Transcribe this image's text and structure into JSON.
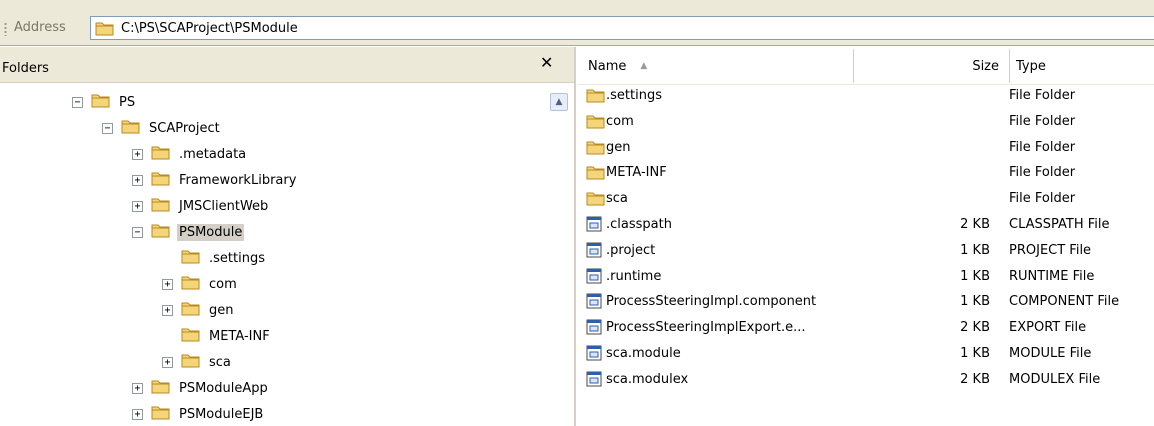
{
  "address": {
    "label": "Address",
    "path": "C:\\PS\\SCAProject\\PSModule"
  },
  "folders_pane": {
    "title": "Folders",
    "close_glyph": "✕",
    "tree": [
      {
        "label": "PS",
        "expander": "⊟"
      },
      {
        "label": "SCAProject",
        "expander": "⊟"
      },
      {
        "label": ".metadata",
        "expander": "⊞"
      },
      {
        "label": "FrameworkLibrary",
        "expander": "⊞"
      },
      {
        "label": "JMSClientWeb",
        "expander": "⊞"
      },
      {
        "label": "PSModule",
        "expander": "⊟",
        "selected": true
      },
      {
        "label": ".settings",
        "expander": ""
      },
      {
        "label": "com",
        "expander": "⊞"
      },
      {
        "label": "gen",
        "expander": "⊞"
      },
      {
        "label": "META-INF",
        "expander": ""
      },
      {
        "label": "sca",
        "expander": "⊞"
      },
      {
        "label": "PSModuleApp",
        "expander": "⊞"
      },
      {
        "label": "PSModuleEJB",
        "expander": "⊞"
      }
    ]
  },
  "files_pane": {
    "columns": {
      "name": "Name",
      "size": "Size",
      "type": "Type"
    },
    "sort_column": "name",
    "sort_direction": "ascending",
    "files": [
      {
        "name": ".settings",
        "size": "",
        "type": "File Folder",
        "icon": "folder-icon"
      },
      {
        "name": "com",
        "size": "",
        "type": "File Folder",
        "icon": "folder-icon"
      },
      {
        "name": "gen",
        "size": "",
        "type": "File Folder",
        "icon": "folder-icon"
      },
      {
        "name": "META-INF",
        "size": "",
        "type": "File Folder",
        "icon": "folder-icon"
      },
      {
        "name": "sca",
        "size": "",
        "type": "File Folder",
        "icon": "folder-icon"
      },
      {
        "name": ".classpath",
        "size": "2 KB",
        "type": "CLASSPATH File",
        "icon": "file-icon"
      },
      {
        "name": ".project",
        "size": "1 KB",
        "type": "PROJECT File",
        "icon": "file-icon"
      },
      {
        "name": ".runtime",
        "size": "1 KB",
        "type": "RUNTIME File",
        "icon": "file-icon"
      },
      {
        "name": "ProcessSteeringImpl.component",
        "size": "1 KB",
        "type": "COMPONENT File",
        "icon": "file-icon"
      },
      {
        "name": "ProcessSteeringImplExport.e...",
        "size": "2 KB",
        "type": "EXPORT File",
        "icon": "file-icon"
      },
      {
        "name": "sca.module",
        "size": "1 KB",
        "type": "MODULE File",
        "icon": "file-icon"
      },
      {
        "name": "sca.modulex",
        "size": "2 KB",
        "type": "MODULEX File",
        "icon": "file-icon"
      }
    ]
  },
  "colors": {
    "toolbar_bg": "#ece9d8",
    "folder_fill": "#f5d57a",
    "folder_stroke": "#b88a1e",
    "selection_bg": "#d4d0c8",
    "address_border": "#7f9db9"
  }
}
